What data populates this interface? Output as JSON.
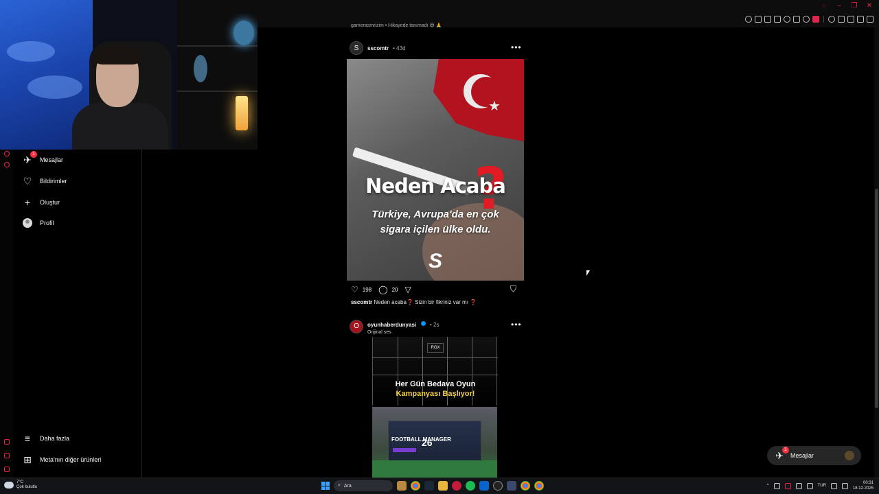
{
  "feed_top_caption": "gamerasmrizim • Hikayede tanımadı 😅 🙏",
  "sidebar": {
    "items": [
      {
        "label": "Mesajlar",
        "badge": "1"
      },
      {
        "label": "Bildirimler"
      },
      {
        "label": "Oluştur"
      },
      {
        "label": "Profil"
      }
    ],
    "bottom": [
      {
        "label": "Daha fazla"
      },
      {
        "label": "Meta'nın diğer ürünleri"
      }
    ]
  },
  "post1": {
    "username": "sscomtr",
    "time": "• 43d",
    "image": {
      "headline": "Neden Acaba",
      "line1": "Türkiye, Avrupa'da en çok",
      "line2": "sigara içilen ülke oldu."
    },
    "likes": "198",
    "comments": "20",
    "caption_user": "sscomtr",
    "caption_text": "Neden acaba❓ Sizin bir fikriniz var mı ❓"
  },
  "post2": {
    "username": "oyunhaberdunyasi",
    "time": "• 2s",
    "subtitle": "Orijinal ses",
    "image": {
      "badge": "RGX",
      "line1": "Her Gün Bedava Oyun",
      "line2": "Kampanyası Başlıyor!",
      "game_title": "FOOTBALL MANAGER",
      "game_number": "26"
    }
  },
  "messages_pill": {
    "label": "Mesajlar",
    "badge": "1"
  },
  "taskbar": {
    "weather_temp": "7°C",
    "weather_desc": "Çok bulutlu",
    "search_placeholder": "Ara",
    "language": "TUR",
    "time": "00:31",
    "date": "18.12.2025"
  },
  "colors": {
    "badge": "#ff3040",
    "accent_red": "#e0244b",
    "verified": "#0095f6",
    "pill_bg": "#262626"
  }
}
